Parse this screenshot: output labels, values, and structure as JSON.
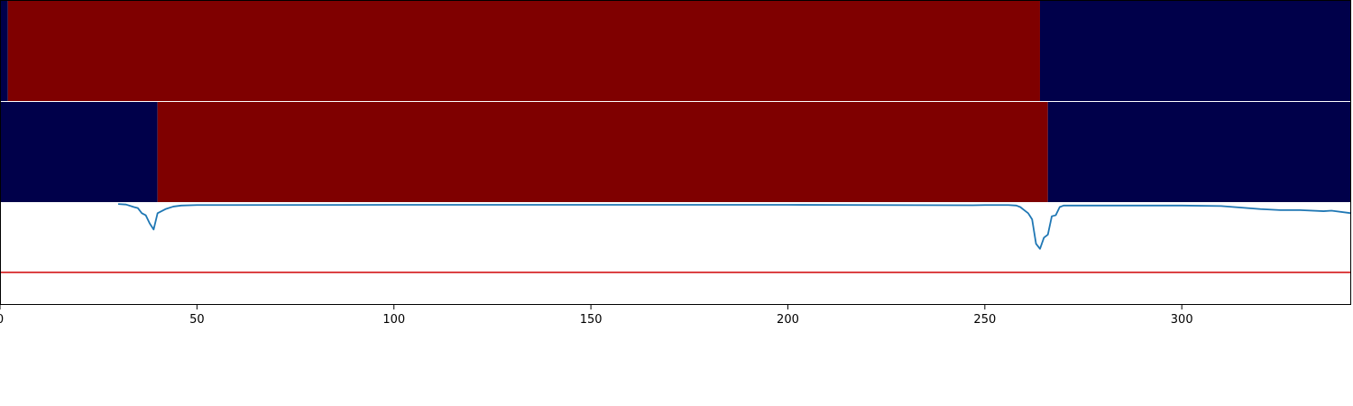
{
  "chart_data": {
    "type": "line",
    "title": "",
    "xlabel": "",
    "ylabel": "",
    "xlim": [
      0,
      343
    ],
    "ylim": [
      0,
      1
    ],
    "grid": false,
    "x_ticks": [
      0,
      50,
      100,
      150,
      200,
      250,
      300
    ],
    "x_tick_labels": [
      "0",
      "50",
      "100",
      "150",
      "200",
      "250",
      "300"
    ],
    "segment_tracks": [
      {
        "segments": [
          {
            "start": 0,
            "end": 2,
            "state": "low"
          },
          {
            "start": 2,
            "end": 264,
            "state": "high"
          },
          {
            "start": 264,
            "end": 343,
            "state": "low"
          }
        ]
      },
      {
        "segments": [
          {
            "start": 0,
            "end": 40,
            "state": "low"
          },
          {
            "start": 40,
            "end": 266,
            "state": "high"
          },
          {
            "start": 266,
            "end": 343,
            "state": "low"
          }
        ]
      }
    ],
    "state_colors": {
      "low": "#00004a",
      "high": "#7f0000"
    },
    "series": [
      {
        "color": "#1f77b4",
        "x": [
          30,
          32,
          34,
          35,
          36,
          37,
          38,
          39,
          40,
          42,
          44,
          46,
          50,
          100,
          150,
          200,
          247,
          250,
          256,
          258,
          259,
          260,
          261,
          262,
          263,
          264,
          265,
          266,
          267,
          268,
          269,
          270,
          272,
          280,
          300,
          310,
          320,
          325,
          330,
          336,
          338,
          343
        ],
        "y": [
          0.99,
          0.985,
          0.96,
          0.95,
          0.9,
          0.88,
          0.8,
          0.74,
          0.9,
          0.94,
          0.965,
          0.975,
          0.98,
          0.982,
          0.982,
          0.982,
          0.978,
          0.98,
          0.98,
          0.975,
          0.96,
          0.93,
          0.9,
          0.84,
          0.6,
          0.55,
          0.66,
          0.69,
          0.87,
          0.88,
          0.96,
          0.975,
          0.975,
          0.975,
          0.975,
          0.97,
          0.94,
          0.93,
          0.93,
          0.92,
          0.925,
          0.9
        ]
      }
    ],
    "threshold": {
      "y": 0.32,
      "color": "#d62728"
    }
  }
}
